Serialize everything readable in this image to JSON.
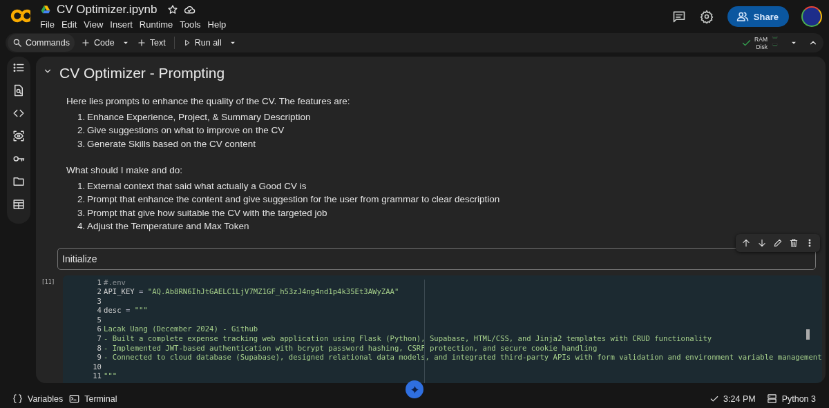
{
  "app": {
    "file_name": "CV Optimizer.ipynb",
    "starred": false,
    "saved_to_drive": true,
    "menu": [
      "File",
      "Edit",
      "View",
      "Insert",
      "Runtime",
      "Tools",
      "Help"
    ],
    "share_label": "Share"
  },
  "toolbar": {
    "commands": "Commands",
    "add_code": "Code",
    "add_text": "Text",
    "run_all": "Run all",
    "runtime": {
      "connected": true,
      "ram": {
        "label": "RAM"
      },
      "disk": {
        "label": "Disk"
      }
    }
  },
  "sidebar": {
    "items": [
      {
        "kind": "toc"
      },
      {
        "kind": "find"
      },
      {
        "kind": "snippets"
      },
      {
        "kind": "inspect"
      },
      {
        "kind": "secrets"
      },
      {
        "kind": "files"
      },
      {
        "kind": "data"
      }
    ]
  },
  "cells": [
    {
      "kind": "markdown",
      "expanded": true,
      "heading": "CV Optimizer - Prompting",
      "blocks": [
        {
          "kind": "paragraph",
          "text": "Here lies prompts to enhance the quality of the CV. The features are:"
        },
        {
          "kind": "list",
          "items": [
            {
              "marker": "1.",
              "text": "Enhance Experience, Project, & Summary Description"
            },
            {
              "marker": "2.",
              "text": "Give suggestions on what to improve on the CV"
            },
            {
              "marker": "3.",
              "text": "Generate Skills based on the CV content"
            }
          ]
        },
        {
          "kind": "paragraph",
          "text": "What should I make and do:"
        },
        {
          "kind": "list",
          "items": [
            {
              "marker": "1.",
              "text": "External context that said what actually a Good CV is"
            },
            {
              "marker": "2.",
              "text": "Prompt that enhance the content and give suggestion for the user from grammar to clear description"
            },
            {
              "marker": "3.",
              "text": "Prompt that give how suitable the CV with the targeted job"
            },
            {
              "marker": "4.",
              "text": "Adjust the Temperature and Max Token"
            }
          ]
        }
      ]
    },
    {
      "kind": "markdown_edit",
      "focused": true,
      "text": "Initialize"
    },
    {
      "kind": "code",
      "execution_count": "[11]",
      "lines": [
        {
          "number": "1",
          "segments": [
            {
              "kind": "comment",
              "text": "#.env"
            }
          ]
        },
        {
          "number": "2",
          "segments": [
            {
              "kind": "name",
              "text": "API_KEY "
            },
            {
              "kind": "operator",
              "text": "="
            },
            {
              "kind": "string",
              "text": " \"AQ.Ab8RN6IhJtGAELC1LjV7MZ1GF_h53zJ4ng4nd1p4k35Et3AWyZAA\""
            }
          ]
        },
        {
          "number": "3"
        },
        {
          "number": "4",
          "segments": [
            {
              "kind": "name",
              "text": "desc "
            },
            {
              "kind": "operator",
              "text": "="
            },
            {
              "kind": "string",
              "text": " \"\"\""
            }
          ]
        },
        {
          "number": "5"
        },
        {
          "number": "6",
          "segments": [
            {
              "kind": "string",
              "text": "Lacak Uang (December 2024) - Github"
            }
          ]
        },
        {
          "number": "7",
          "segments": [
            {
              "kind": "string",
              "text": "- Built a complete expense tracking web application using Flask (Python), Supabase, HTML/CSS, and Jinja2 templates with CRUD functionality"
            }
          ]
        },
        {
          "number": "8",
          "segments": [
            {
              "kind": "string",
              "text": "- Implemented JWT-based authentication with bcrypt password hashing, CSRF protection, and secure cookie handling"
            }
          ]
        },
        {
          "number": "9",
          "segments": [
            {
              "kind": "string",
              "text": "- Connected to cloud database (Supabase), designed relational data models, and integrated third-party APIs with form validation and environment variable management"
            }
          ]
        },
        {
          "number": "10"
        },
        {
          "number": "11",
          "segments": [
            {
              "kind": "string",
              "text": "\"\"\""
            }
          ]
        }
      ]
    }
  ],
  "status_bar": {
    "variables": "Variables",
    "terminal": "Terminal",
    "last_run_ok": true,
    "time": "3:24 PM",
    "kernel": "Python 3"
  }
}
